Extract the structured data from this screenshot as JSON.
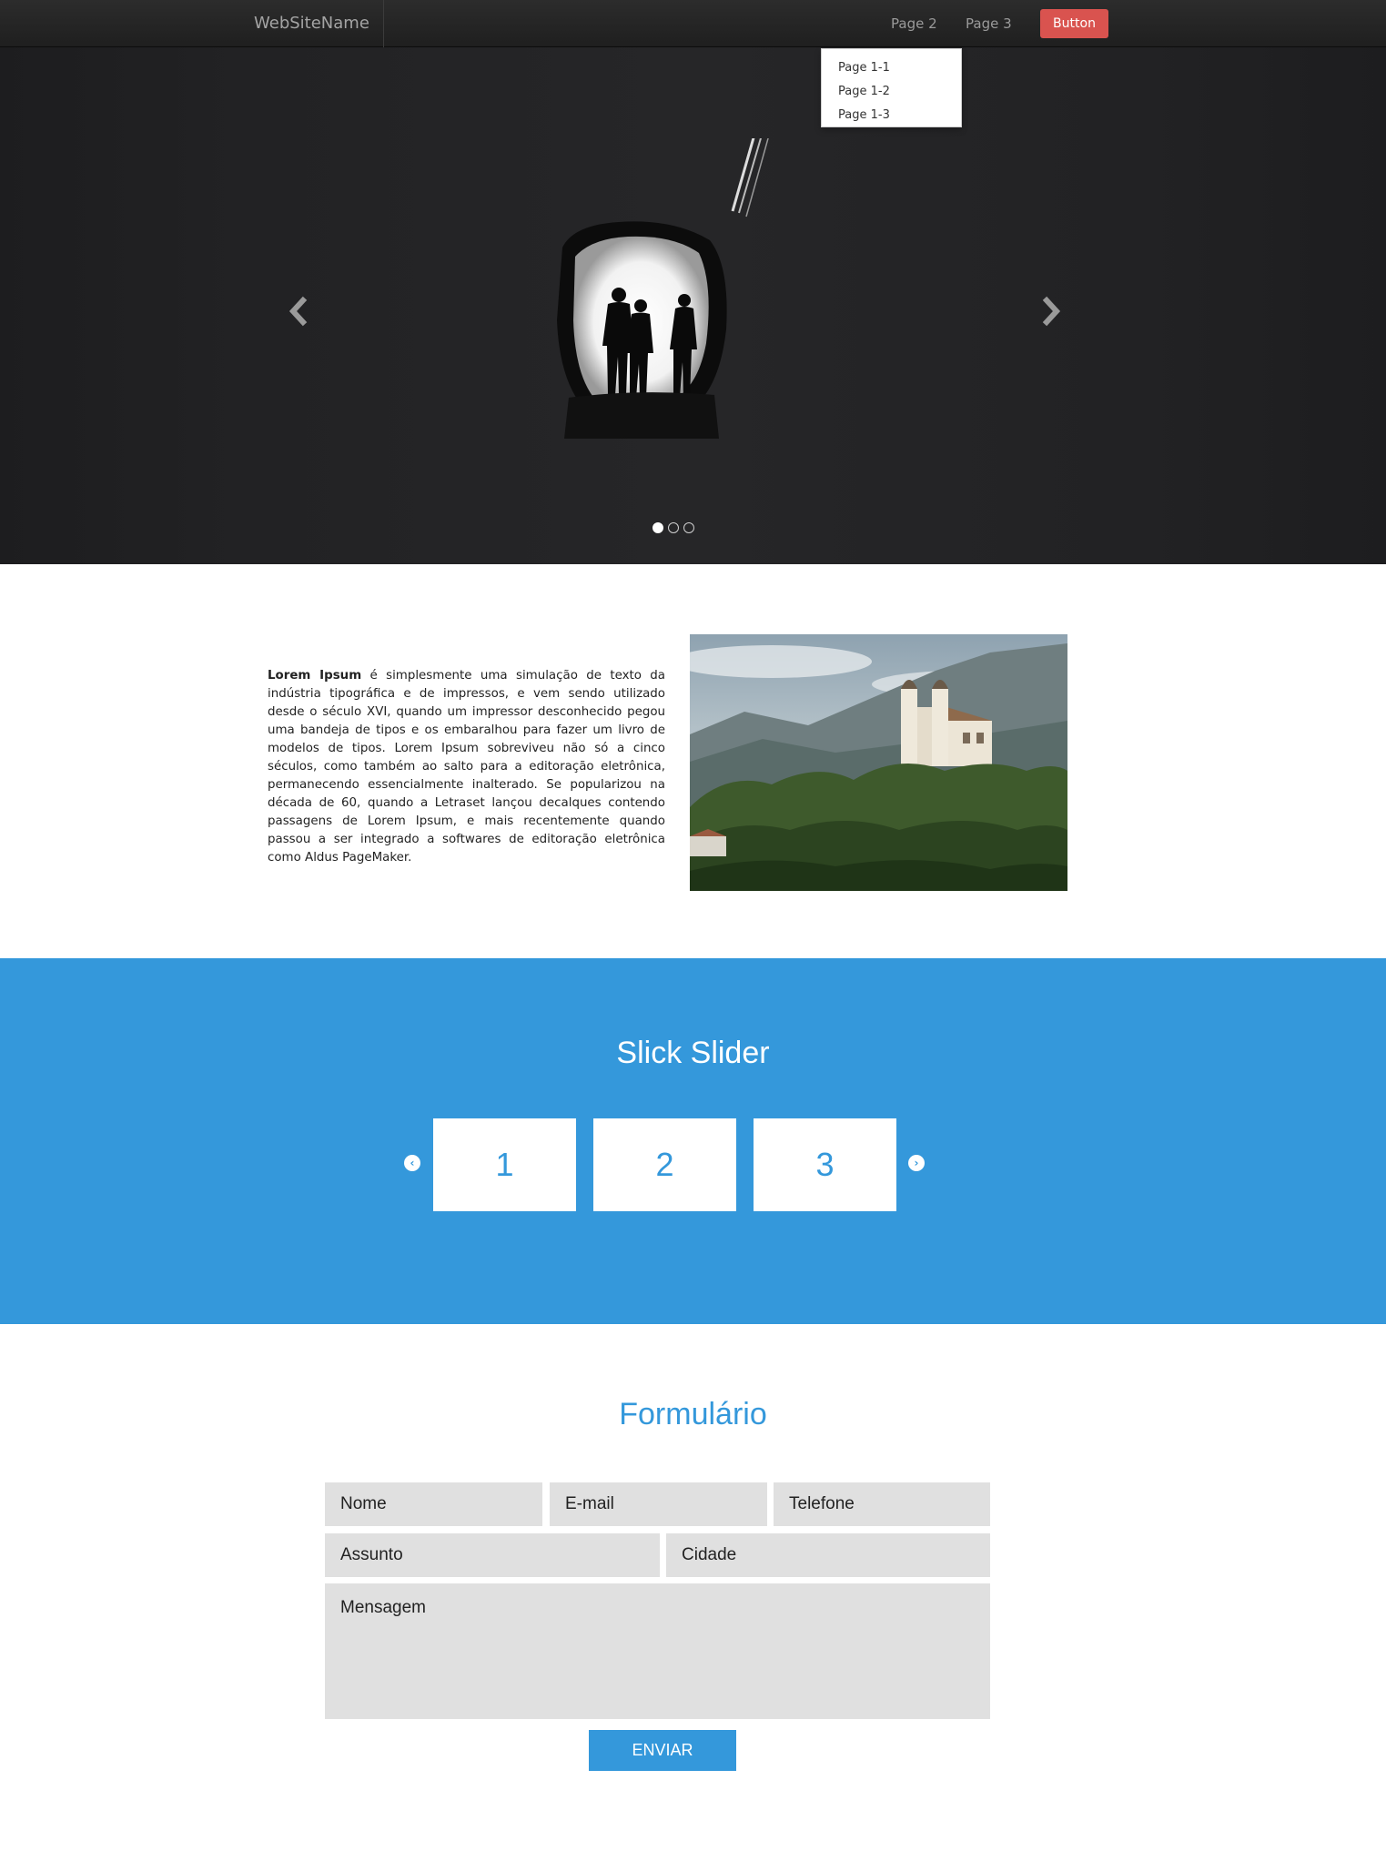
{
  "navbar": {
    "brand": "WebSiteName",
    "links": [
      "Page 2",
      "Page 3"
    ],
    "button": "Button"
  },
  "dropdown": {
    "items": [
      "Page 1-1",
      "Page 1-2",
      "Page 1-3"
    ]
  },
  "carousel": {
    "slide_count": 3,
    "active_slide": 1,
    "prev_icon": "chevron-left-icon",
    "next_icon": "chevron-right-icon"
  },
  "about": {
    "bold_lead": "Lorem Ipsum",
    "text": " é simplesmente uma simulação de texto da indústria tipográfica e de impressos, e vem sendo utilizado desde o século XVI, quando um impressor desconhecido pegou uma bandeja de tipos e os embaralhou para fazer um livro de modelos de tipos. Lorem Ipsum sobreviveu não só a cinco séculos, como também ao salto para a editoração eletrônica, permanecendo essencialmente inalterado. Se popularizou na década de 60, quando a Letraset lançou decalques contendo passagens de Lorem Ipsum, e mais recentemente quando passou a ser integrado a softwares de editoração eletrônica como Aldus PageMaker."
  },
  "slick": {
    "title": "Slick Slider",
    "slides": [
      "1",
      "2",
      "3"
    ],
    "prev_icon": "circle-chevron-left-icon",
    "next_icon": "circle-chevron-right-icon"
  },
  "form": {
    "title": "Formulário",
    "name_placeholder": "Nome",
    "email_placeholder": "E-mail",
    "phone_placeholder": "Telefone",
    "subject_placeholder": "Assunto",
    "city_placeholder": "Cidade",
    "message_placeholder": "Mensagem",
    "submit_label": "ENVIAR"
  },
  "colors": {
    "accent": "#3498db",
    "danger_button": "#d9534f",
    "navbar": "#222222",
    "field_bg": "#e0e0e0"
  }
}
